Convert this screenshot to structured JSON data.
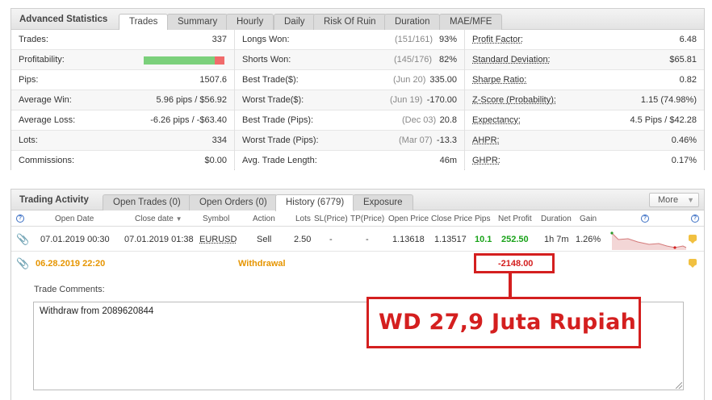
{
  "stats": {
    "title": "Advanced Statistics",
    "tabs": [
      "Trades",
      "Summary",
      "Hourly",
      "Daily",
      "Risk Of Ruin",
      "Duration",
      "MAE/MFE"
    ],
    "col1": [
      {
        "label": "Trades:",
        "value": "337"
      },
      {
        "label": "Profitability:",
        "value": ""
      },
      {
        "label": "Pips:",
        "value": "1507.6"
      },
      {
        "label": "Average Win:",
        "value": "5.96 pips / $56.92"
      },
      {
        "label": "Average Loss:",
        "value": "-6.26 pips / -$63.40"
      },
      {
        "label": "Lots:",
        "value": "334"
      },
      {
        "label": "Commissions:",
        "value": "$0.00"
      }
    ],
    "col2": [
      {
        "label": "Longs Won:",
        "date": "(151/161)",
        "value": "93%"
      },
      {
        "label": "Shorts Won:",
        "date": "(145/176)",
        "value": "82%"
      },
      {
        "label": "Best Trade($):",
        "date": "(Jun 20)",
        "value": "335.00"
      },
      {
        "label": "Worst Trade($):",
        "date": "(Jun 19)",
        "value": "-170.00"
      },
      {
        "label": "Best Trade (Pips):",
        "date": "(Dec 03)",
        "value": "20.8"
      },
      {
        "label": "Worst Trade (Pips):",
        "date": "(Mar 07)",
        "value": "-13.3"
      },
      {
        "label": "Avg. Trade Length:",
        "date": "",
        "value": "46m"
      }
    ],
    "col3": [
      {
        "label": "Profit Factor:",
        "value": "6.48"
      },
      {
        "label": "Standard Deviation:",
        "value": "$65.81"
      },
      {
        "label": "Sharpe Ratio:",
        "value": "0.82"
      },
      {
        "label": "Z-Score (Probability):",
        "value": "1.15 (74.98%)"
      },
      {
        "label": "Expectancy:",
        "value": "4.5 Pips / $42.28"
      },
      {
        "label": "AHPR:",
        "value": "0.46%"
      },
      {
        "label": "GHPR:",
        "value": "0.17%"
      }
    ],
    "profitability_fraction": 0.88,
    "colors": {
      "win": "#7bd07b",
      "loss": "#f06b6b"
    }
  },
  "activity": {
    "title": "Trading Activity",
    "tabs": [
      "Open Trades (0)",
      "Open Orders (0)",
      "History (6779)",
      "Exposure"
    ],
    "more_label": "More",
    "columns": [
      "Open Date",
      "Close date",
      "Symbol",
      "Action",
      "Lots",
      "SL(Price)",
      "TP(Price)",
      "Open Price",
      "Close Price",
      "Pips",
      "Net Profit",
      "Duration",
      "Gain"
    ],
    "sort_indicator": "▼",
    "trade": {
      "open_date": "07.01.2019 00:30",
      "close_date": "07.01.2019 01:38",
      "symbol": "EURUSD",
      "action": "Sell",
      "lots": "2.50",
      "sl": "-",
      "tp": "-",
      "open_price": "1.13618",
      "close_price": "1.13517",
      "pips": "10.1",
      "net_profit": "252.50",
      "duration": "1h 7m",
      "gain": "1.26%"
    },
    "withdrawal": {
      "date": "06.28.2019 22:20",
      "action": "Withdrawal",
      "amount": "-2148.00"
    },
    "comments_label": "Trade Comments:",
    "comment_text": "Withdraw from 2089620844",
    "colors": {
      "positive": "#1aa31a",
      "date_orange": "#e69500",
      "negative": "#d41f1f"
    }
  },
  "annotation": {
    "callout_text": "WD 27,9 Juta Rupiah",
    "color": "#d41f1f"
  }
}
